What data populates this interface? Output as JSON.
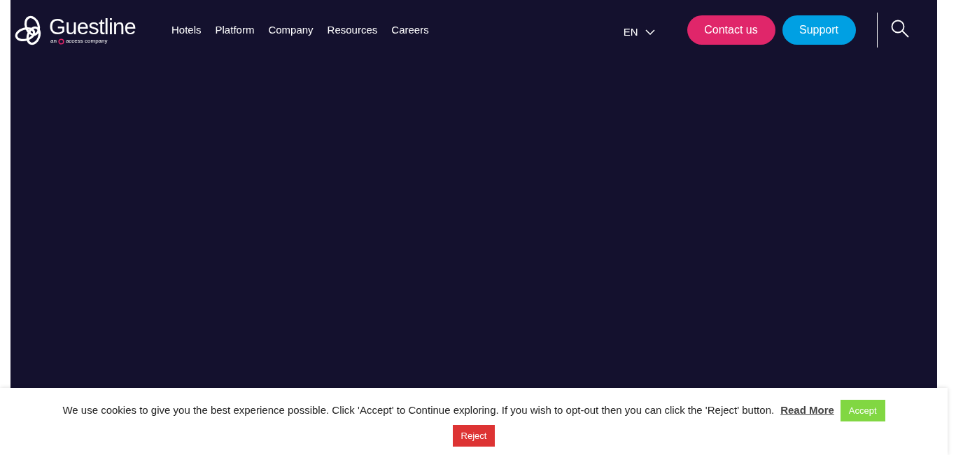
{
  "header": {
    "logo": {
      "name": "Guestline",
      "tagline_before": "an",
      "tagline_after": "access company"
    },
    "nav": [
      "Hotels",
      "Platform",
      "Company",
      "Resources",
      "Careers"
    ],
    "language": "EN",
    "buttons": [
      {
        "label": "Contact us",
        "kind": "contact"
      },
      {
        "label": "Support",
        "kind": "support"
      }
    ]
  },
  "cookie_banner": {
    "message": "We use cookies to give you the best experience possible. Click 'Accept' to Continue exploring. If you wish to opt-out then you can click the 'Reject' button.",
    "link": "Read More",
    "accept": "Accept",
    "reject": "Reject"
  }
}
